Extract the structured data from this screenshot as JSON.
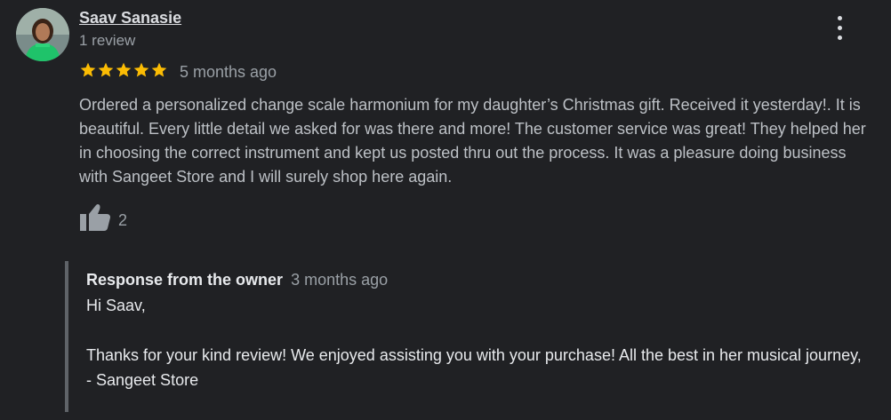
{
  "reviewer": {
    "name": "Saav Sanasie",
    "review_count": "1 review",
    "avatar_icon": "profile-photo"
  },
  "rating": {
    "stars": 5,
    "max_stars": 5,
    "star_color": "#fbbc04"
  },
  "review": {
    "date": "5 months ago",
    "text": "Ordered a personalized change scale harmonium for my daughter’s Christmas gift. Received it yesterday!. It is beautiful. Every little detail we asked for was there and more!  The customer service was great!  They helped her in choosing the correct instrument and kept us posted thru out the process. It was a pleasure doing business with Sangeet Store and I will surely shop here again.",
    "like_icon": "thumbs-up-icon",
    "like_count": "2"
  },
  "more_menu": {
    "icon": "more-vert-icon"
  },
  "owner_response": {
    "title": "Response from the owner",
    "date": "3 months ago",
    "lines": [
      "Hi Saav,",
      "",
      "Thanks for your kind review! We enjoyed assisting you with your purchase! All the best in her musical journey,",
      "- Sangeet Store"
    ]
  },
  "colors": {
    "background": "#202124",
    "primary_text": "#e8eaed",
    "secondary_text": "#9aa0a6",
    "response_border": "#5f6368"
  }
}
